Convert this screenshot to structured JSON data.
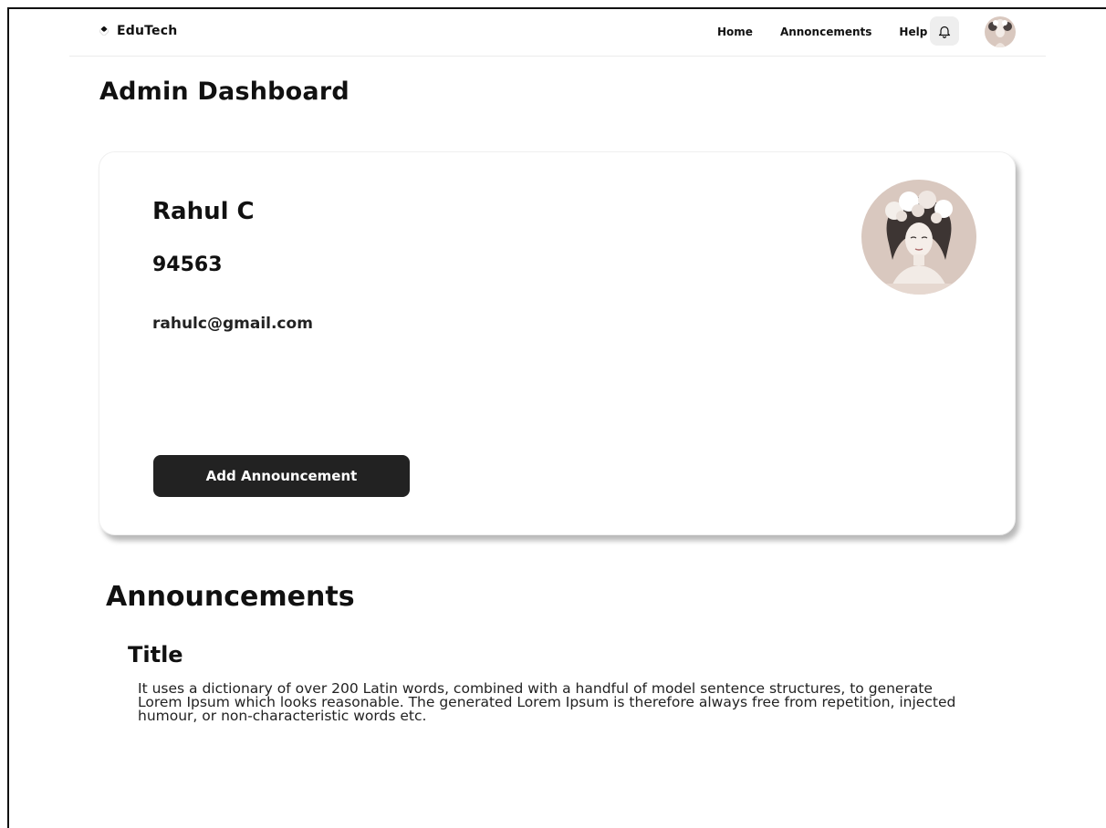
{
  "brand": {
    "name": "EduTech"
  },
  "nav": {
    "links": [
      {
        "label": "Home"
      },
      {
        "label": "Annoncements"
      },
      {
        "label": "Help"
      }
    ]
  },
  "page": {
    "title": "Admin Dashboard"
  },
  "profile": {
    "name": "Rahul C",
    "id": "94563",
    "email": "rahulc@gmail.com",
    "add_button_label": "Add Announcement"
  },
  "announcements": {
    "section_title": "Announcements",
    "items": [
      {
        "title": "Title",
        "body": "It uses a dictionary of over 200 Latin words, combined with a handful of model sentence structures, to generate Lorem Ipsum which looks reasonable. The generated Lorem Ipsum is therefore always free from repetition, injected humour, or non-characteristic words etc."
      }
    ]
  },
  "icons": {
    "brand": "brand-logo-icon",
    "notifications": "bell-icon"
  },
  "colors": {
    "button_bg": "#222222",
    "button_text": "#ffffff",
    "bell_bg": "#eeeeee",
    "avatar_bg": "#d9c8bf"
  }
}
